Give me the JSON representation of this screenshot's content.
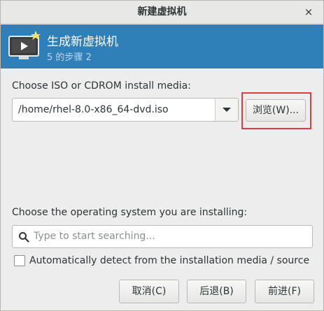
{
  "window": {
    "title": "新建虚拟机",
    "close_icon": "×"
  },
  "header": {
    "icon": "computer-monitor-icon",
    "title": "生成新虚拟机",
    "step": "5 的步骤 2"
  },
  "media": {
    "label": "Choose ISO or CDROM install media:",
    "path": "/home/rhel-8.0-x86_64-dvd.iso",
    "browse_label": "浏览(W)..."
  },
  "os": {
    "label": "Choose the operating system you are installing:",
    "search_placeholder": "Type to start searching...",
    "auto_detect_label": "Automatically detect from the installation media / source",
    "auto_detect_checked": false
  },
  "buttons": {
    "cancel": "取消(C)",
    "back": "后退(B)",
    "forward": "前进(F)"
  },
  "colors": {
    "header_bg": "#2f7fb9",
    "highlight": "#e03c3c"
  }
}
